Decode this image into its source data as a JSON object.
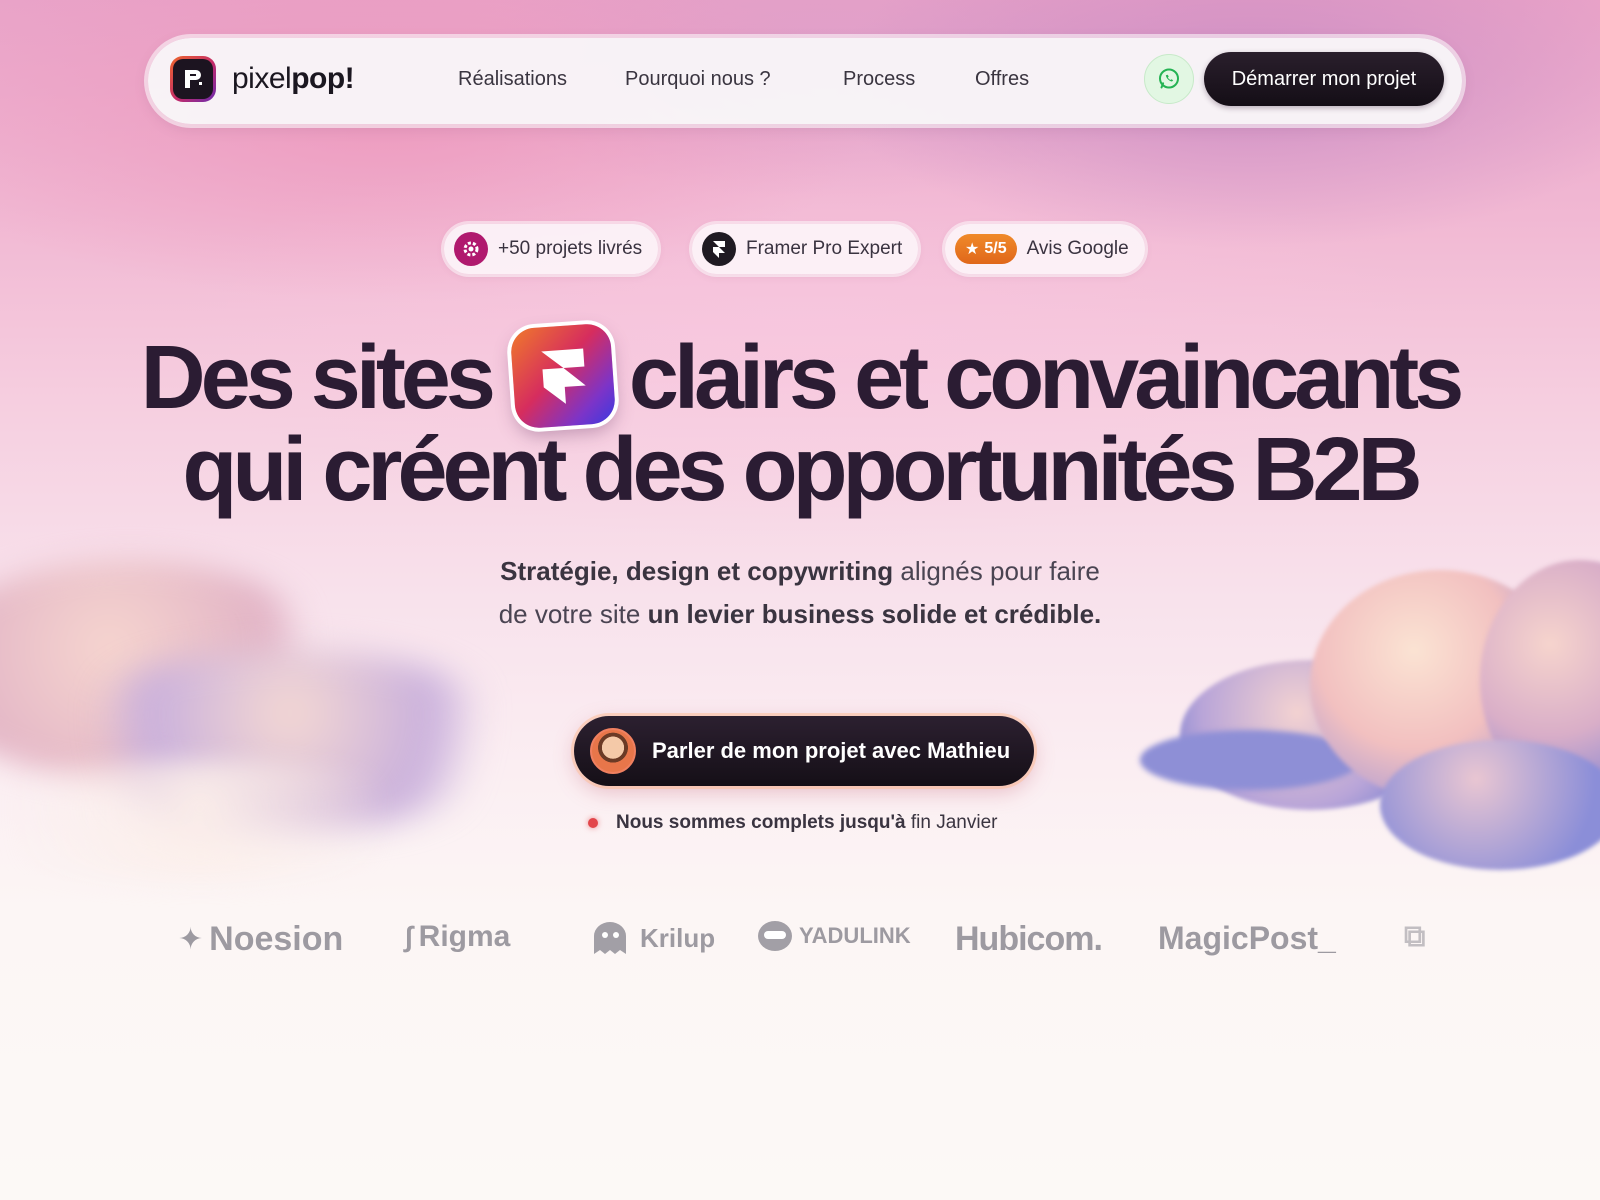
{
  "nav": {
    "brand_light": "pixel",
    "brand_bold": "pop!",
    "links": [
      "Réalisations",
      "Pourquoi nous ?",
      "Process",
      "Offres"
    ],
    "cta_label": "Démarrer mon projet"
  },
  "badges": {
    "projects": "+50 projets livrés",
    "framer": "Framer Pro Expert",
    "rating": "5/5",
    "google": "Avis Google"
  },
  "hero": {
    "line1_a": "Des sites",
    "line1_b": "clairs et convaincants",
    "line2": "qui créent des opportunités B2B",
    "sub_bold1": "Stratégie, design et copywriting",
    "sub_text1": " alignés pour faire",
    "sub_text2": "de votre site ",
    "sub_bold2": "un levier business solide et crédible.",
    "cta_label": "Parler de mon projet avec Mathieu",
    "availability_bold": "Nous sommes complets jusqu'à",
    "availability_text": "fin Janvier"
  },
  "clients": [
    "Noesion",
    "Rigma",
    "Krilup",
    "YADULINK",
    "Hubicom.",
    "MagicPost_"
  ],
  "colors": {
    "accent_dark": "#1b1420",
    "heading": "#2b1c33",
    "rating_orange": "#e8721f",
    "whatsapp_green": "#25d366"
  }
}
